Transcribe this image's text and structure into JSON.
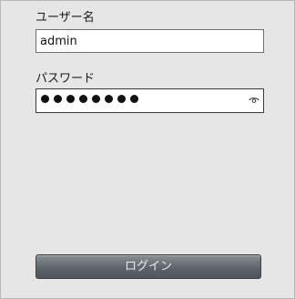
{
  "form": {
    "username_label": "ユーザー名",
    "username_value": "admin",
    "password_label": "パスワード",
    "password_length": 8,
    "show_password_icon": "eye-icon",
    "login_label": "ログイン"
  },
  "colors": {
    "panel_bg": "#e6e6e6",
    "button_bg": "#5e646b",
    "button_text": "#e9ecef"
  }
}
